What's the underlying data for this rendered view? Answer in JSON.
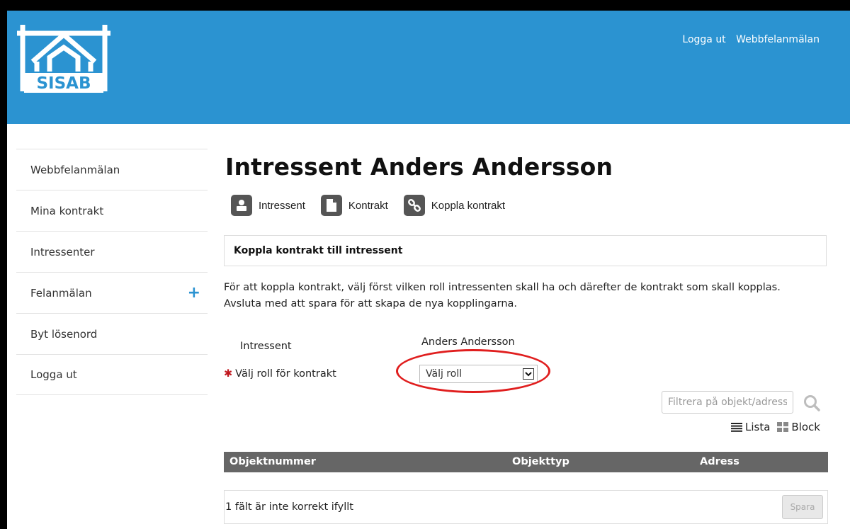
{
  "brand": {
    "logo_text": "SISAB"
  },
  "top_links": [
    "Logga ut",
    "Webbfelanmälan"
  ],
  "sidebar": {
    "items": [
      {
        "label": "Webbfelanmälan"
      },
      {
        "label": "Mina kontrakt"
      },
      {
        "label": "Intressenter"
      },
      {
        "label": "Felanmälan",
        "action": "+"
      },
      {
        "label": "Byt lösenord"
      },
      {
        "label": "Logga ut"
      }
    ]
  },
  "page": {
    "title": "Intressent Anders Andersson"
  },
  "tabs": [
    {
      "label": "Intressent",
      "icon": "user-icon"
    },
    {
      "label": "Kontrakt",
      "icon": "document-icon"
    },
    {
      "label": "Koppla kontrakt",
      "icon": "link-icon"
    }
  ],
  "panel": {
    "header": "Koppla kontrakt till intressent"
  },
  "instructions": {
    "line1": "För att koppla kontrakt, välj först vilken roll intressenten skall ha och därefter de kontrakt som skall kopplas.",
    "line2": "Avsluta med att spara för att skapa de nya kopplingarna."
  },
  "form": {
    "intressent_label": "Intressent",
    "intressent_value": "Anders Andersson",
    "role_label": "Välj roll för kontrakt",
    "required_mark": "✱",
    "role_value": "Välj roll"
  },
  "filter": {
    "placeholder": "Filtrera på objekt/adress"
  },
  "view_toggle": {
    "list": "Lista",
    "block": "Block"
  },
  "table": {
    "columns": [
      "Objektnummer",
      "Objekttyp",
      "Adress"
    ]
  },
  "footer": {
    "message": "1 fält är inte korrekt ifyllt",
    "save_label": "Spara"
  },
  "colors": {
    "header_bg": "#2b93d1",
    "highlight": "#e01e1e",
    "table_header": "#666666"
  }
}
